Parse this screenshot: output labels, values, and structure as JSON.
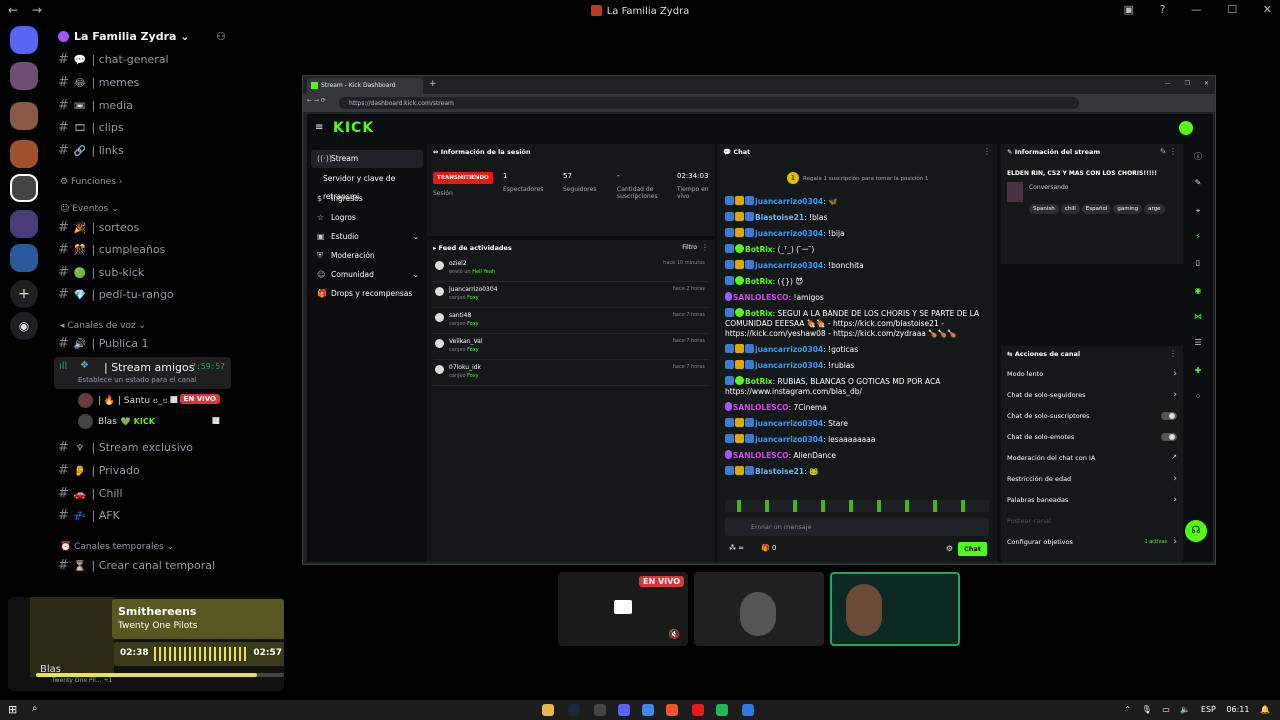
{
  "window": {
    "title": "La Familia Zydra",
    "back": "←",
    "forward": "→"
  },
  "guild": {
    "name": "La Familia Zydra ⌄"
  },
  "text_channels": [
    {
      "label": "| chat-general",
      "emoji": "💬"
    },
    {
      "label": "| memes",
      "emoji": "😂"
    },
    {
      "label": "| media",
      "emoji": "📼"
    },
    {
      "label": "| clips",
      "emoji": "🎞"
    },
    {
      "label": "| links",
      "emoji": "🔗"
    }
  ],
  "categories": {
    "funciones": "Funciones ›",
    "eventos": "Eventos ⌄",
    "voz": "Canales de voz ⌄",
    "temporales": "Canales temporales ⌄"
  },
  "event_channels": [
    {
      "label": "| sorteos",
      "emoji": "🎉"
    },
    {
      "label": "| cumpleaños",
      "emoji": "🎊"
    },
    {
      "label": "| sub-kick",
      "emoji": "🟢"
    },
    {
      "label": "| pedí-tu-rango",
      "emoji": "💎"
    }
  ],
  "voice_channels": [
    {
      "label": "| Publica 1"
    },
    {
      "label": "| Stream exclusivo"
    },
    {
      "label": "| Privado"
    },
    {
      "label": "| Chill"
    },
    {
      "label": "| AFK"
    }
  ],
  "active_voice": {
    "name": "| Stream amigos",
    "time": "7:59:57",
    "status": "Establece un estado para el canal"
  },
  "members": [
    {
      "name": "| 🔥 | Santu ೮_೮",
      "badge": "EN VIVO"
    },
    {
      "name": "Blas",
      "kick": "KICK"
    }
  ],
  "temp_channel": "| Crear canal temporal",
  "music": {
    "song": "Smithereens",
    "artist": "Twenty One Pilots",
    "elapsed": "02:38",
    "total": "02:57",
    "progress": 0.89,
    "user": "Blas",
    "sub": "Twenty One Pil... +1"
  },
  "browser": {
    "tab": "Stream - Kick Dashboard",
    "url": "https://dashboard.kick.com/stream"
  },
  "kick": {
    "logo": "KICK",
    "nav": [
      {
        "label": "Stream",
        "icon": "((·))"
      },
      {
        "label": "Servidor y clave de retransmi",
        "icon": ""
      },
      {
        "label": "Ingresos",
        "icon": "$"
      },
      {
        "label": "Logros",
        "icon": "☆"
      },
      {
        "label": "Estudio",
        "icon": "▣",
        "chev": "⌄"
      },
      {
        "label": "Moderación",
        "icon": "⛨"
      },
      {
        "label": "Comunidad",
        "icon": "☺",
        "chev": "⌄"
      },
      {
        "label": "Drops y recompensas",
        "icon": "🎁"
      }
    ],
    "session": {
      "header": "Información de la sesión",
      "status": "TRANSMITIENDO",
      "session_label": "Sesión",
      "stats": [
        {
          "value": "1",
          "label": "Espectadores"
        },
        {
          "value": "57",
          "label": "Seguidores"
        },
        {
          "value": "-",
          "label": "Cantidad de suscripciones"
        },
        {
          "value": "02:34:03",
          "label": "Tiempo en vivo"
        }
      ]
    },
    "feed": {
      "header": "Feed de actividades",
      "filter": "Filtro",
      "rows": [
        {
          "name": "oziel2",
          "desc": "envió un",
          "item": "Hell Yeah",
          "ago": "hace 10 minutos"
        },
        {
          "name": "juancarrizo0304",
          "desc": "canjeó",
          "item": "Foxy",
          "ago": "hace 2 horas"
        },
        {
          "name": "santi48",
          "desc": "canjeó",
          "item": "Foxy",
          "ago": "hace 7 horas"
        },
        {
          "name": "Velikan_Val",
          "desc": "canjeó",
          "item": "Foxy",
          "ago": "hace 7 horas"
        },
        {
          "name": "07loku_idk",
          "desc": "canjeó",
          "item": "Foxy",
          "ago": "hace 7 horas"
        }
      ]
    },
    "chat": {
      "header": "Chat",
      "goal": "Regala 1 suscripción para tomar la posición 1",
      "messages": [
        {
          "user": "juancarrizo0304",
          "color": "#3a9bff",
          "text": ": 🦋"
        },
        {
          "user": "Blastoise21",
          "color": "#6cb4ff",
          "text": ": !blas"
        },
        {
          "user": "juancarrizo0304",
          "color": "#3a9bff",
          "text": ": !bija"
        },
        {
          "user": "BotRix",
          "color": "#53fc18",
          "text": ": (_ᵀ_) ( ̄ー ̄)"
        },
        {
          "user": "juancarrizo0304",
          "color": "#3a9bff",
          "text": ": !bonchita"
        },
        {
          "user": "BotRix",
          "color": "#53fc18",
          "text": ": ({}) 😈"
        },
        {
          "user": "SANLOLESCO",
          "color": "#e040fb",
          "text": ": !amigos"
        },
        {
          "user": "BotRix",
          "color": "#53fc18",
          "text": ": SEGUI A LA BANDE DE LOS CHORIS Y SE PARTE DE LA COMUNIDAD EEESAA 🍖🍖 - https://kick.com/blastoise21 - https://kick.com/yeshaw08 - https://kick.com/zydraaa 🍗🍗🍗"
        },
        {
          "user": "juancarrizo0304",
          "color": "#3a9bff",
          "text": ": !goticas"
        },
        {
          "user": "juancarrizo0304",
          "color": "#3a9bff",
          "text": ": !rubias"
        },
        {
          "user": "BotRix",
          "color": "#53fc18",
          "text": ": RUBIAS, BLANCAS O GOTICAS MD POR ACA https://www.instagram.com/blas_db/"
        },
        {
          "user": "SANLOLESCO",
          "color": "#e040fb",
          "text": ": 7Cinema"
        },
        {
          "user": "juancarrizo0304",
          "color": "#3a9bff",
          "text": ": Stare"
        },
        {
          "user": "juancarrizo0304",
          "color": "#3a9bff",
          "text": ": lesaaaaaaaa"
        },
        {
          "user": "SANLOLESCO",
          "color": "#e040fb",
          "text": ": AlienDance"
        },
        {
          "user": "Blastoise21",
          "color": "#6cb4ff",
          "text": ": 🐸"
        }
      ],
      "placeholder": "Enviar un mensaje",
      "points": "0",
      "send": "Chat"
    },
    "stream_info": {
      "header": "Información del stream",
      "title": "ELDEN RIN, CS2 Y MAS CON LOS CHORIS!!!!!",
      "category": "Conversando",
      "tags": [
        "Spanish",
        "chill",
        "Español",
        "gaming",
        "arge"
      ]
    },
    "actions": {
      "header": "Acciones de canal",
      "items": [
        {
          "label": "Modo lento",
          "kind": "chev"
        },
        {
          "label": "Chat de solo-seguidores",
          "kind": "chev"
        },
        {
          "label": "Chat de solo-suscriptores",
          "kind": "toggle"
        },
        {
          "label": "Chat de solo-emotes",
          "kind": "toggle"
        },
        {
          "label": "Moderación del chat con IA",
          "kind": "ext"
        },
        {
          "label": "Restricción de edad",
          "kind": "chev"
        },
        {
          "label": "Palabras baneadas",
          "kind": "chev"
        },
        {
          "label": "Postear canal",
          "kind": "none"
        },
        {
          "label": "Configurar objetivos",
          "kind": "chev",
          "extra": "1 activas"
        }
      ]
    }
  },
  "thumbs": {
    "live": "EN VIVO"
  },
  "taskbar": {
    "lang": "ESP",
    "time": "06:11"
  },
  "colors": {
    "kick_green": "#53fc18",
    "discord_bg": "#000000",
    "live_red": "#da373c"
  }
}
